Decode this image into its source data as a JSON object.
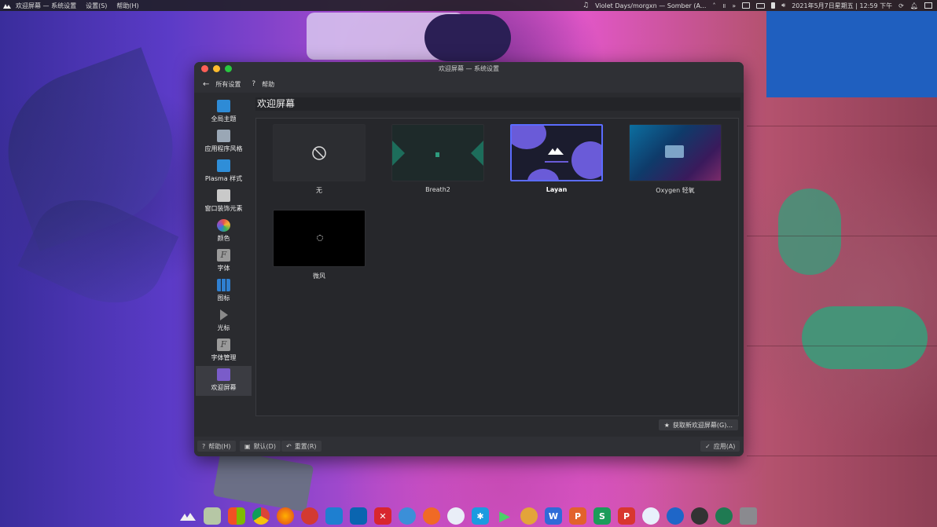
{
  "topbar": {
    "app_name": "欢迎屏幕 — 系统设置",
    "menus": [
      "设置(S)",
      "帮助(H)"
    ],
    "media": "Violet Days/morgxn — Somber (A...",
    "datetime": "2021年5月7日星期五 | 12:59 下午"
  },
  "window": {
    "title": "欢迎屏幕 — 系统设置",
    "toolbar": {
      "all_settings": "所有设置",
      "help_icon": "?",
      "help": "帮助"
    },
    "sidebar": [
      {
        "label": "全局主题",
        "icon": "global-theme-icon",
        "color": "#2e8bd6"
      },
      {
        "label": "应用程序风格",
        "icon": "app-style-icon",
        "color": "#9aa7b5"
      },
      {
        "label": "Plasma 样式",
        "icon": "plasma-style-icon",
        "color": "#2f8ed8"
      },
      {
        "label": "窗口装饰元素",
        "icon": "window-decoration-icon",
        "color": "#c9c9c9"
      },
      {
        "label": "颜色",
        "icon": "colors-icon",
        "color": "#e5524a"
      },
      {
        "label": "字体",
        "icon": "font-icon",
        "color": "#9a9a9a"
      },
      {
        "label": "图标",
        "icon": "icons-icon",
        "color": "#2f7fd0"
      },
      {
        "label": "光标",
        "icon": "cursor-icon",
        "color": "#8a8a8a"
      },
      {
        "label": "字体管理",
        "icon": "font-management-icon",
        "color": "#9a9a9a"
      },
      {
        "label": "欢迎屏幕",
        "icon": "splash-screen-icon",
        "color": "#7a5cc9"
      }
    ],
    "heading": "欢迎屏幕",
    "themes": [
      {
        "name": "无",
        "selected": false
      },
      {
        "name": "Breath2",
        "selected": false
      },
      {
        "name": "Layan",
        "selected": true
      },
      {
        "name": "Oxygen 轻氧",
        "selected": false
      },
      {
        "name": "微风",
        "selected": false
      }
    ],
    "get_new": "获取新欢迎屏幕(G)...",
    "buttons": {
      "help": "帮助(H)",
      "defaults": "默认(D)",
      "reset": "重置(R)",
      "apply": "应用(A)"
    }
  },
  "dock": [
    "kde-icon",
    "files-icon",
    "windows-icon",
    "chrome-icon",
    "firefox-icon",
    "netease-music-icon",
    "vscode-blue-icon",
    "vscode-icon",
    "xmind-icon",
    "cloud-icon",
    "pen-icon",
    "qq-icon",
    "star-app-icon",
    "play-icon",
    "potato-icon",
    "wps-writer-icon",
    "wps-presentation-icon",
    "wps-spreadsheet-icon",
    "wps-pdf-icon",
    "baidu-netdisk-icon",
    "typora-icon",
    "obs-icon",
    "kdeconnect-icon",
    "trash-icon"
  ],
  "colors": {
    "accent": "#5b6cff",
    "window_bg": "#2a2b2f"
  }
}
